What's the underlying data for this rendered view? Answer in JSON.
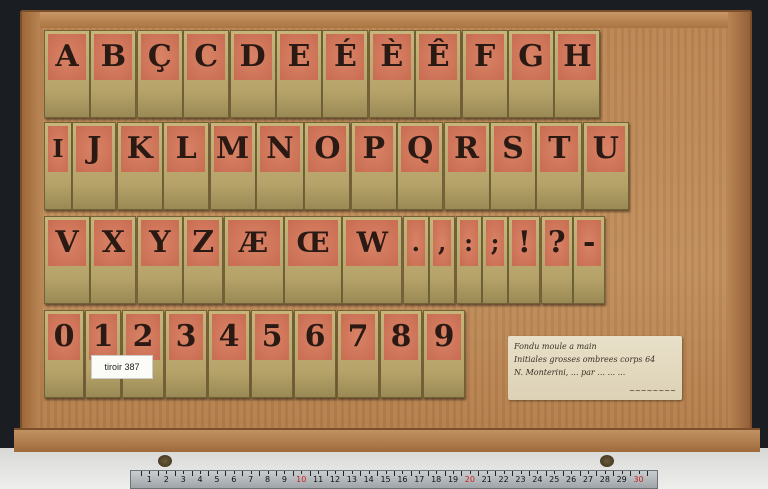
{
  "rows": [
    [
      "A",
      "B",
      "Ç",
      "C",
      "D",
      "E",
      "É",
      "È",
      "Ê",
      "F",
      "G",
      "H"
    ],
    [
      "I",
      "J",
      "K",
      "L",
      "M",
      "N",
      "O",
      "P",
      "Q",
      "R",
      "S",
      "T",
      "U"
    ],
    [
      "V",
      "X",
      "Y",
      "Z",
      "Æ",
      "Œ",
      "W",
      ".",
      ",",
      ":",
      ";",
      "!",
      "?",
      "-"
    ],
    [
      "0",
      "1",
      "2",
      "3",
      "4",
      "5",
      "6",
      "7",
      "8",
      "9"
    ]
  ],
  "tag": "tiroir 387",
  "note": {
    "lines": [
      "Fondu moule a main",
      "Initiales grosses ombrees corps 64",
      "N. Monterini, ... par ... ... ..."
    ]
  },
  "ruler": {
    "numbers": [
      "1",
      "2",
      "3",
      "4",
      "5",
      "6",
      "7",
      "8",
      "9",
      "10",
      "11",
      "12",
      "13",
      "14",
      "15",
      "16",
      "17",
      "18",
      "19",
      "20",
      "21",
      "22",
      "23",
      "24",
      "25",
      "26",
      "27",
      "28",
      "29",
      "30"
    ]
  }
}
